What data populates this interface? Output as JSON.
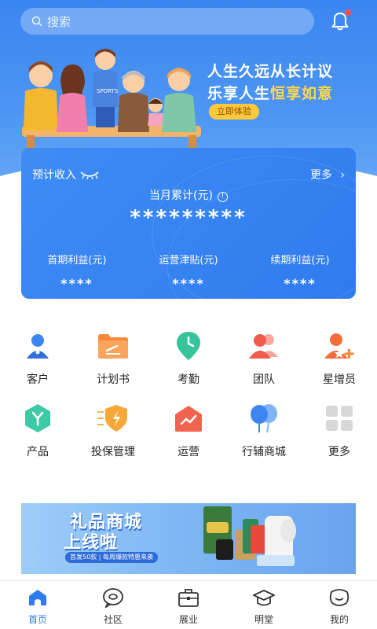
{
  "search": {
    "placeholder": "搜索"
  },
  "hero": {
    "slogan_line1": "人生久远从长计议",
    "slogan_line2_prefix": "乐享人生",
    "slogan_line2_highlight": "恒享如意",
    "cta": "立即体验"
  },
  "income": {
    "title": "预计收入",
    "more": "更多",
    "month_label": "当月累计(元)",
    "month_total": "*********",
    "columns": [
      {
        "label": "首期利益(元)",
        "value": "****"
      },
      {
        "label": "运营津贴(元)",
        "value": "****"
      },
      {
        "label": "续期利益(元)",
        "value": "****"
      }
    ]
  },
  "features": [
    {
      "label": "客户",
      "icon": "customer-icon"
    },
    {
      "label": "计划书",
      "icon": "plan-icon"
    },
    {
      "label": "考勤",
      "icon": "attendance-icon"
    },
    {
      "label": "团队",
      "icon": "team-icon"
    },
    {
      "label": "星增员",
      "icon": "recruit-icon"
    },
    {
      "label": "产品",
      "icon": "product-icon"
    },
    {
      "label": "投保管理",
      "icon": "insure-icon"
    },
    {
      "label": "运营",
      "icon": "operation-icon"
    },
    {
      "label": "行辅商城",
      "icon": "mall-icon"
    },
    {
      "label": "更多",
      "icon": "more-grid-icon"
    }
  ],
  "banner": {
    "title1": "礼品商城",
    "title2": "上线啦",
    "tag": "首发50款 | 每周爆款特惠来袭"
  },
  "tabs": [
    {
      "label": "首页",
      "active": true
    },
    {
      "label": "社区",
      "active": false
    },
    {
      "label": "展业",
      "active": false
    },
    {
      "label": "明堂",
      "active": false
    },
    {
      "label": "我的",
      "active": false
    }
  ],
  "colors": {
    "primary": "#2f7bef",
    "accent_yellow": "#ffc93c",
    "orange": "#f6893a"
  }
}
